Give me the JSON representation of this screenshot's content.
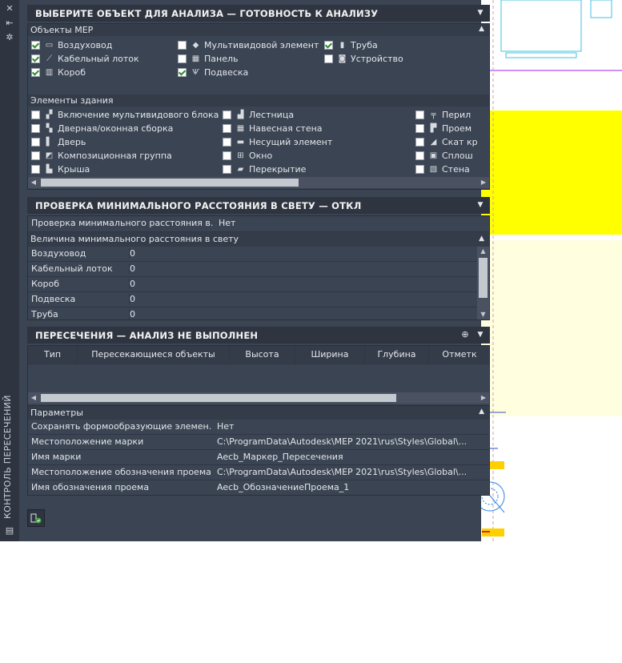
{
  "palette": {
    "vertical_title": "КОНТРОЛЬ ПЕРЕСЕЧЕНИЙ"
  },
  "selection_panel": {
    "title": "ВЫБЕРИТЕ ОБЪЕКТ ДЛЯ АНАЛИЗА — ГОТОВНОСТЬ К АНАЛИЗУ",
    "mep_group": {
      "label": "Объекты MEP",
      "items": [
        {
          "label": "Воздуховод",
          "checked": true,
          "icon": "duct-icon"
        },
        {
          "label": "Кабельный лоток",
          "checked": true,
          "icon": "cable-tray-icon"
        },
        {
          "label": "Короб",
          "checked": true,
          "icon": "conduit-icon"
        },
        {
          "label": "Мультивидовой элемент",
          "checked": false,
          "icon": "multiview-part-icon"
        },
        {
          "label": "Панель",
          "checked": false,
          "icon": "panel-icon"
        },
        {
          "label": "Подвеска",
          "checked": true,
          "icon": "hanger-icon"
        },
        {
          "label": "Труба",
          "checked": true,
          "icon": "pipe-icon"
        },
        {
          "label": "Устройство",
          "checked": false,
          "icon": "device-icon"
        }
      ]
    },
    "building_group": {
      "label": "Элементы здания",
      "items": [
        {
          "label": "Включение мультивидового блока",
          "checked": false,
          "icon": "mvblock-icon"
        },
        {
          "label": "Дверная/оконная сборка",
          "checked": false,
          "icon": "door-window-assembly-icon"
        },
        {
          "label": "Дверь",
          "checked": false,
          "icon": "door-icon"
        },
        {
          "label": "Композиционная группа",
          "checked": false,
          "icon": "composition-group-icon"
        },
        {
          "label": "Крыша",
          "checked": false,
          "icon": "roof-icon"
        },
        {
          "label": "Лестница",
          "checked": false,
          "icon": "stair-icon"
        },
        {
          "label": "Навесная стена",
          "checked": false,
          "icon": "curtain-wall-icon"
        },
        {
          "label": "Несущий элемент",
          "checked": false,
          "icon": "structural-member-icon"
        },
        {
          "label": "Окно",
          "checked": false,
          "icon": "window-icon"
        },
        {
          "label": "Перекрытие",
          "checked": false,
          "icon": "slab-icon"
        },
        {
          "label": "Перил",
          "checked": false,
          "icon": "railing-icon"
        },
        {
          "label": "Проем",
          "checked": false,
          "icon": "opening-icon"
        },
        {
          "label": "Скат кр",
          "checked": false,
          "icon": "roof-slab-icon"
        },
        {
          "label": "Сплош",
          "checked": false,
          "icon": "solid-icon"
        },
        {
          "label": "Стена",
          "checked": false,
          "icon": "wall-icon"
        }
      ]
    }
  },
  "clearance_panel": {
    "title": "ПРОВЕРКА МИНИМАЛЬНОГО РАССТОЯНИЯ В СВЕТУ — ОТКЛ",
    "check_row": {
      "label": "Проверка минимального расстояния в...",
      "value": "Нет"
    },
    "group_label": "Величина минимального расстояния в свету",
    "rows": [
      {
        "label": "Воздуховод",
        "value": "0"
      },
      {
        "label": "Кабельный лоток",
        "value": "0"
      },
      {
        "label": "Короб",
        "value": "0"
      },
      {
        "label": "Подвеска",
        "value": "0"
      },
      {
        "label": "Труба",
        "value": "0"
      }
    ]
  },
  "intersections_panel": {
    "title": "ПЕРЕСЕЧЕНИЯ — АНАЛИЗ НЕ ВЫПОЛНЕН",
    "columns": [
      "Тип",
      "Пересекающиеся объекты",
      "Высота",
      "Ширина",
      "Глубина",
      "Отметк"
    ]
  },
  "parameters": {
    "label": "Параметры",
    "rows": [
      {
        "label": "Сохранять формообразующие элемен...",
        "value": "Нет"
      },
      {
        "label": "Местоположение марки",
        "value": "C:\\ProgramData\\Autodesk\\MEP 2021\\rus\\Styles\\Global\\..."
      },
      {
        "label": "Имя марки",
        "value": "Aecb_Маркер_Пересечения"
      },
      {
        "label": "Местоположение обозначения проема",
        "value": "C:\\ProgramData\\Autodesk\\MEP 2021\\rus\\Styles\\Global\\..."
      },
      {
        "label": "Имя обозначения проема",
        "value": "Aecb_ОбозначениеПроема_1"
      }
    ]
  },
  "colors": {
    "palette_bg": "#3b4453",
    "header_bg": "#2e3440",
    "highlight_yellow": "#ffff00",
    "check_green": "#2f8c2f"
  }
}
